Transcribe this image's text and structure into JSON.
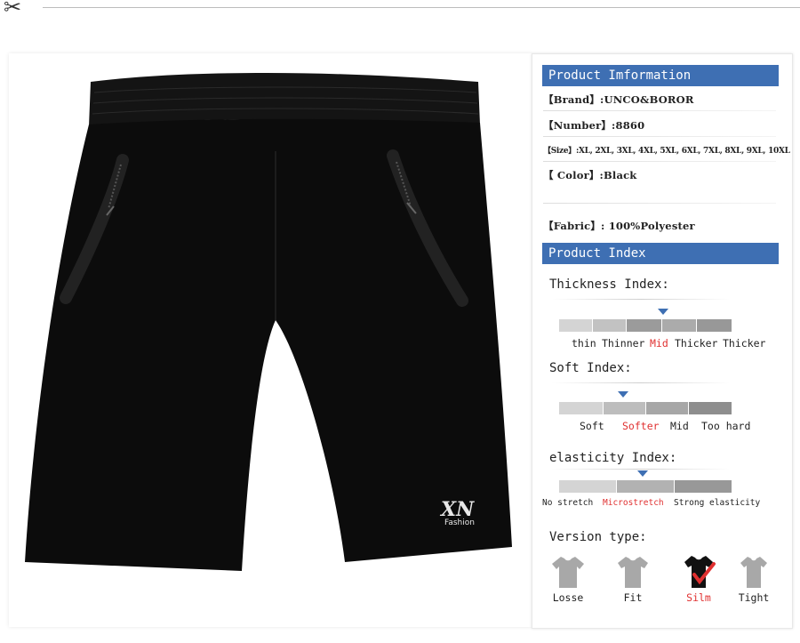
{
  "product_info": {
    "header": "Product Imformation",
    "brand": "【Brand】:UNCO&BOROR",
    "number": "【Number】:8860",
    "size": "【Size】:XL, 2XL, 3XL, 4XL, 5XL, 6XL, 7XL, 8XL, 9XL, 10XL",
    "color": "【 Color】:Black",
    "fabric": "【Fabric】: 100%Polyester"
  },
  "product_index": {
    "header": "Product Index",
    "thickness": {
      "title": "Thickness Index:",
      "options": [
        "thin",
        "Thinner",
        "Mid",
        "Thicker",
        "Thicker"
      ],
      "selected_index": 2
    },
    "soft": {
      "title": "Soft Index:",
      "options": [
        "Soft",
        "Softer",
        "Mid",
        "Too hard"
      ],
      "selected_index": 1
    },
    "elasticity": {
      "title": "elasticity Index:",
      "options": [
        "No stretch",
        "Microstretch",
        "Strong elasticity"
      ],
      "selected_index": 1
    },
    "version": {
      "title": "Version type:",
      "options": [
        "Losse",
        "Fit",
        "Silm",
        "Tight"
      ],
      "selected_index": 2
    }
  },
  "logo": {
    "mark": "XN",
    "text": "Fashion"
  },
  "colors": {
    "accent": "#3e6fb3",
    "highlight": "#e03030",
    "shorts": "#0c0c0c"
  },
  "icons": [
    "scissors-icon",
    "tshirt-icon",
    "checkmark-icon",
    "selection-arrow-icon"
  ]
}
